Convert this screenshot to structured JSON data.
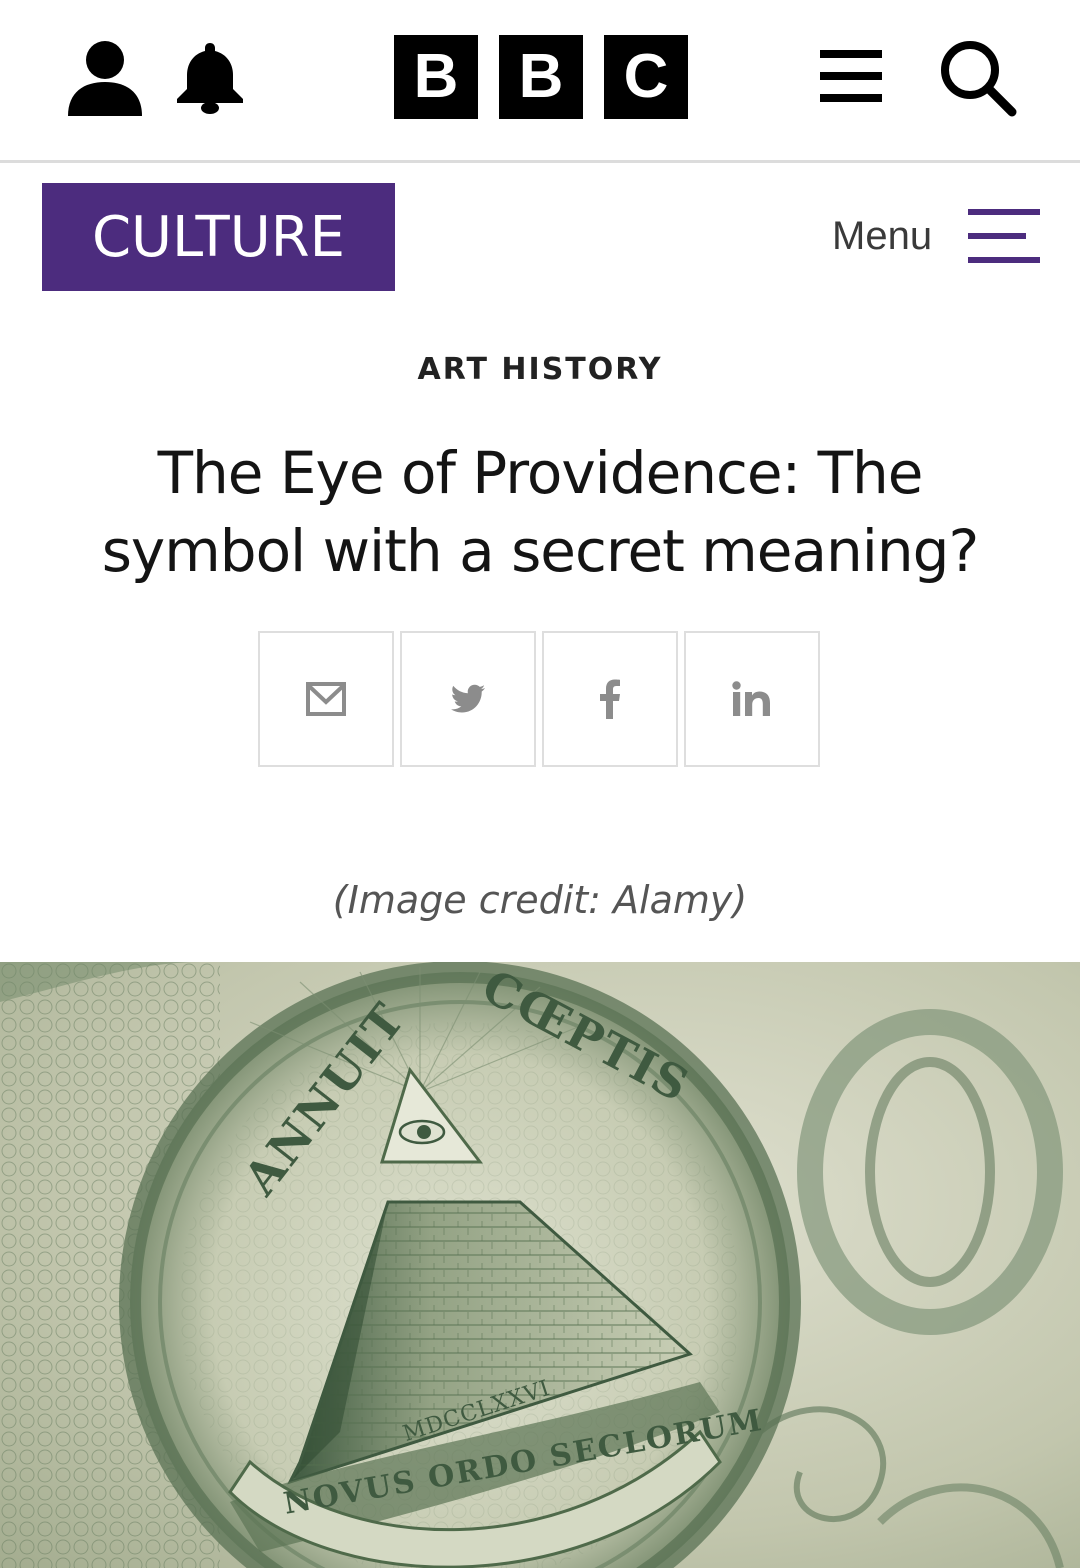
{
  "brand": {
    "letters": [
      "B",
      "B",
      "C"
    ]
  },
  "section": {
    "logo_text": "CULTURE",
    "color": "#4c2c7e"
  },
  "nav": {
    "menu_label": "Menu"
  },
  "article": {
    "kicker": "ART HISTORY",
    "headline": "The Eye of Providence: The symbol with a secret meaning?",
    "image_credit": "(Image credit: Alamy)"
  },
  "share": {
    "buttons": [
      "email-icon",
      "twitter-icon",
      "facebook-icon",
      "linkedin-icon"
    ]
  },
  "hero_image": {
    "text_top_left": "ANNUIT",
    "text_top_right": "CŒPTIS",
    "text_bottom": "NOVUS ORDO SECLORUM",
    "text_base": "MDCCLXXVI"
  }
}
